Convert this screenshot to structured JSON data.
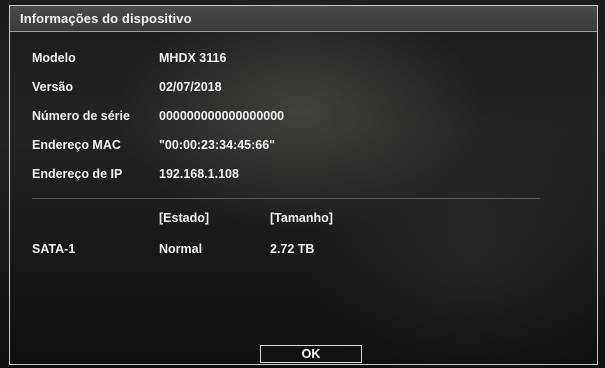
{
  "window": {
    "title": "Informações do dispositivo"
  },
  "info": {
    "model_label": "Modelo",
    "model_value": "MHDX 3116",
    "version_label": "Versão",
    "version_value": "02/07/2018",
    "serial_label": "Número de série",
    "serial_value": "000000000000000000",
    "mac_label": "Endereço MAC",
    "mac_value": "\"00:00:23:34:45:66\"",
    "ip_label": "Endereço de IP",
    "ip_value": "192.168.1.108"
  },
  "storage": {
    "headers": [
      "[Estado]",
      "[Tamanho]"
    ],
    "rows": [
      {
        "name": "SATA-1",
        "status": "Normal",
        "size": "2.72 TB"
      }
    ]
  },
  "buttons": {
    "ok_label": "OK"
  }
}
